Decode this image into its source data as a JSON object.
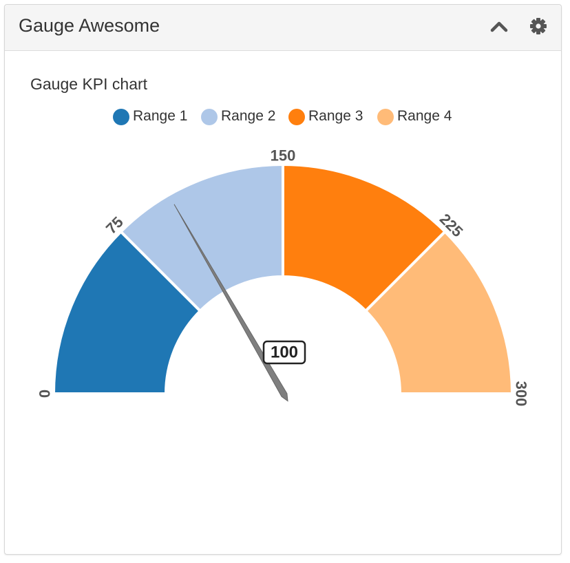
{
  "panel": {
    "title": "Gauge Awesome",
    "collapse_icon": "chevron-up-icon",
    "settings_icon": "gear-icon"
  },
  "chart_data": {
    "type": "gauge",
    "title": "Gauge KPI chart",
    "min": 0,
    "max": 300,
    "value": 100,
    "value_label": "100",
    "ranges": [
      {
        "name": "Range 1",
        "from": 0,
        "to": 75,
        "color": "#1f77b4"
      },
      {
        "name": "Range 2",
        "from": 75,
        "to": 150,
        "color": "#aec7e8"
      },
      {
        "name": "Range 3",
        "from": 150,
        "to": 225,
        "color": "#ff7f0e"
      },
      {
        "name": "Range 4",
        "from": 225,
        "to": 300,
        "color": "#ffbb78"
      }
    ],
    "tick_labels": [
      "0",
      "75",
      "150",
      "225",
      "300"
    ],
    "tick_values": [
      0,
      75,
      150,
      225,
      300
    ],
    "legend_position": "top-center",
    "needle_color": "#7f7f7f"
  }
}
